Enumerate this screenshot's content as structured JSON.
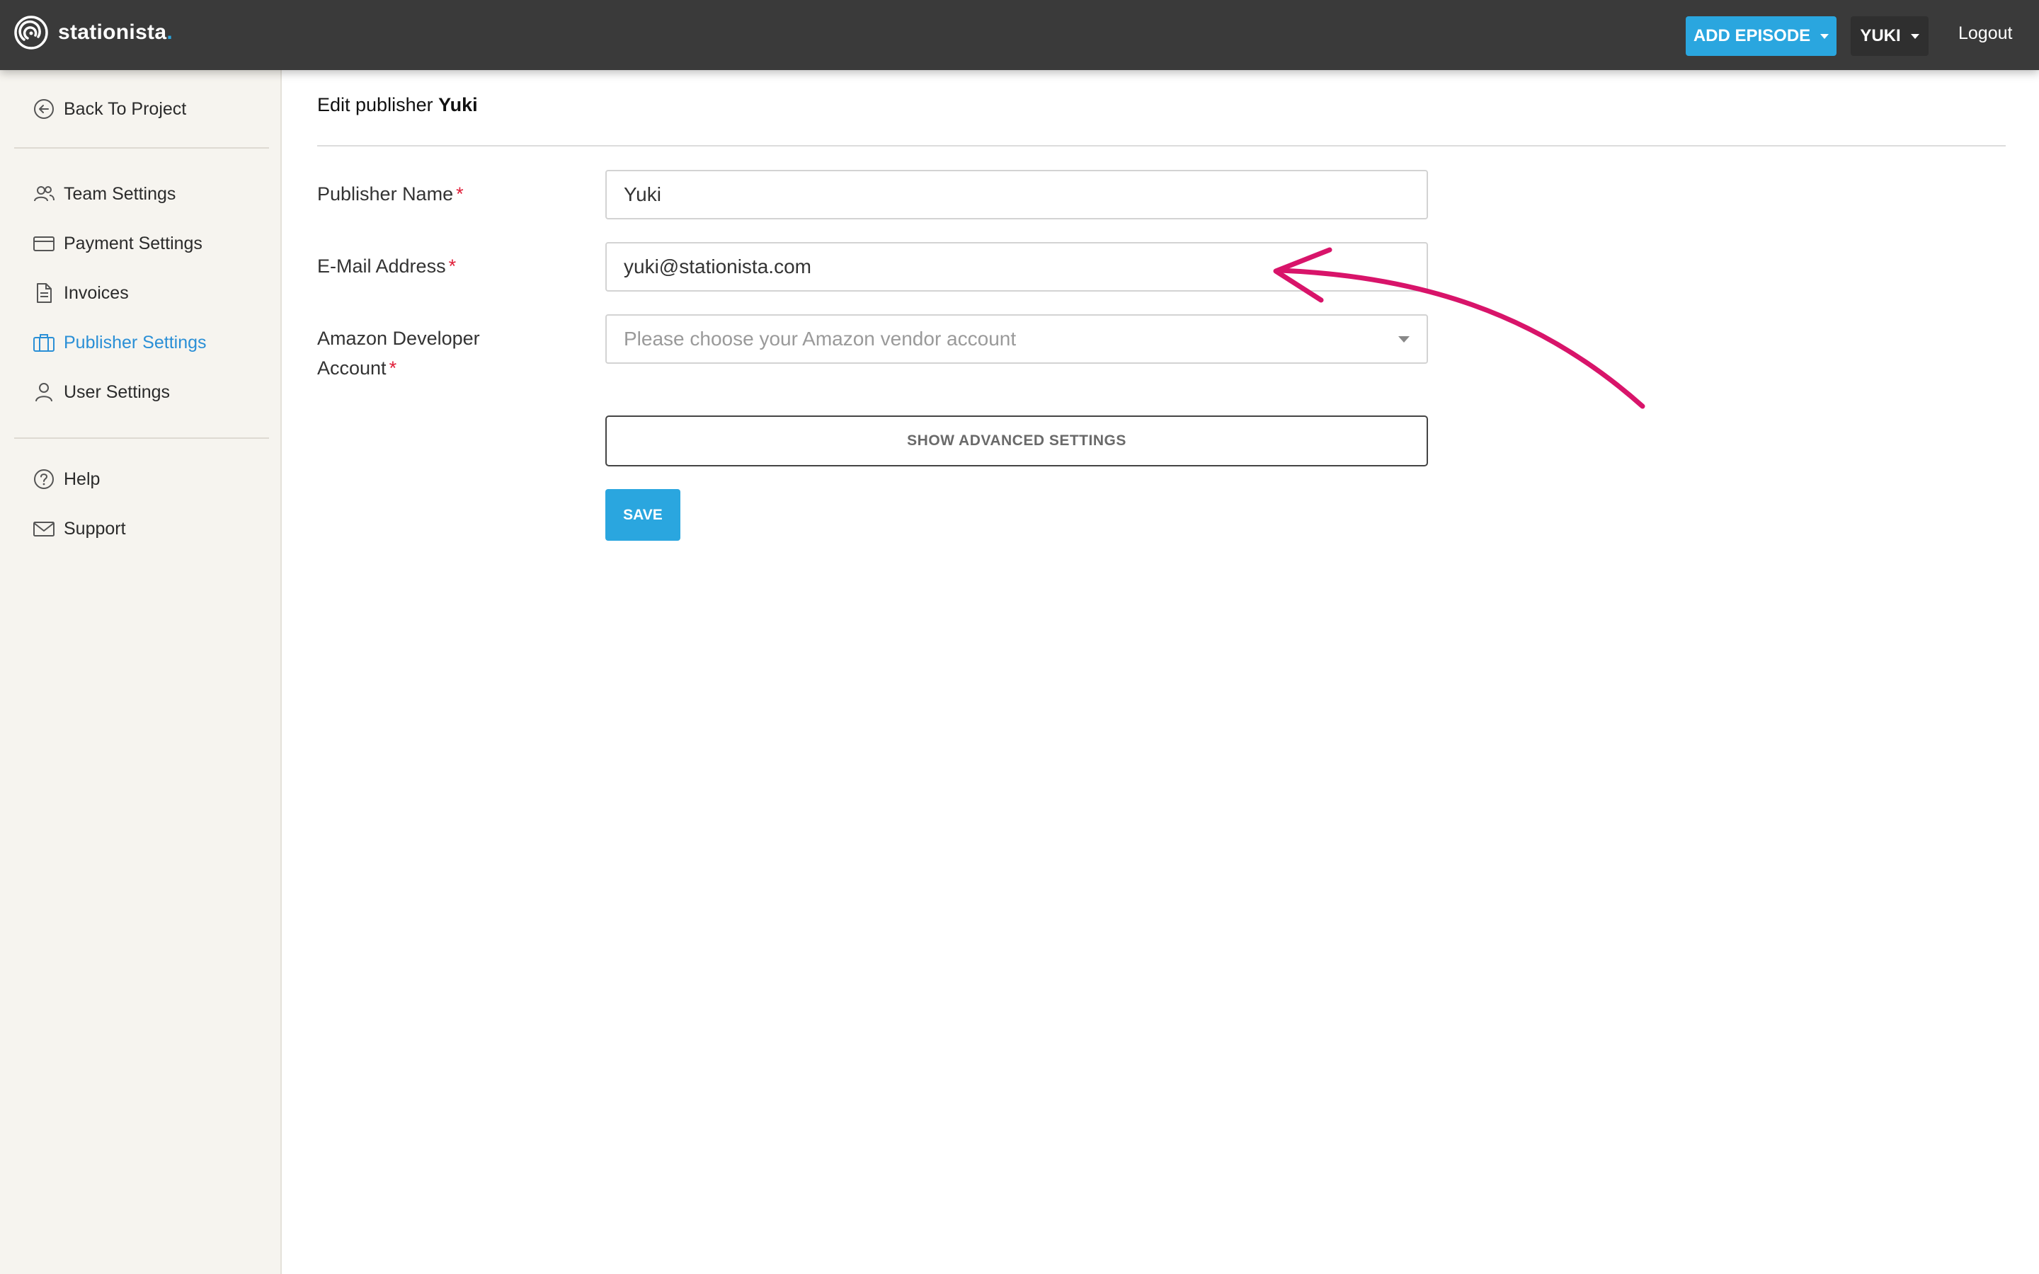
{
  "header": {
    "brand": "stationista",
    "brand_dot": ".",
    "add_episode_label": "ADD EPISODE",
    "user_label": "YUKI",
    "logout_label": "Logout"
  },
  "sidebar": {
    "back_label": "Back To Project",
    "items": [
      {
        "label": "Team Settings",
        "icon": "team-icon"
      },
      {
        "label": "Payment Settings",
        "icon": "credit-card-icon"
      },
      {
        "label": "Invoices",
        "icon": "document-icon"
      },
      {
        "label": "Publisher Settings",
        "icon": "briefcase-icon",
        "active": true
      },
      {
        "label": "User Settings",
        "icon": "user-icon"
      }
    ],
    "help_label": "Help",
    "support_label": "Support"
  },
  "main": {
    "title_prefix": "Edit publisher",
    "title_name": "Yuki",
    "fields": {
      "publisher_name_label": "Publisher Name",
      "publisher_name_value": "Yuki",
      "email_label": "E-Mail Address",
      "email_value": "yuki@stationista.com",
      "amazon_label_line1": "Amazon Developer",
      "amazon_label_line2": "Account",
      "amazon_placeholder": "Please choose your Amazon vendor account",
      "required_mark": "*"
    },
    "advanced_label": "SHOW ADVANCED SETTINGS",
    "save_label": "SAVE"
  },
  "colors": {
    "accent": "#2aa6df",
    "active_nav": "#2a8fd6",
    "required": "#e0203a",
    "annotation_arrow": "#d8146a",
    "topbar": "#3a3a3a",
    "sidebar_bg": "#f6f4ef"
  }
}
